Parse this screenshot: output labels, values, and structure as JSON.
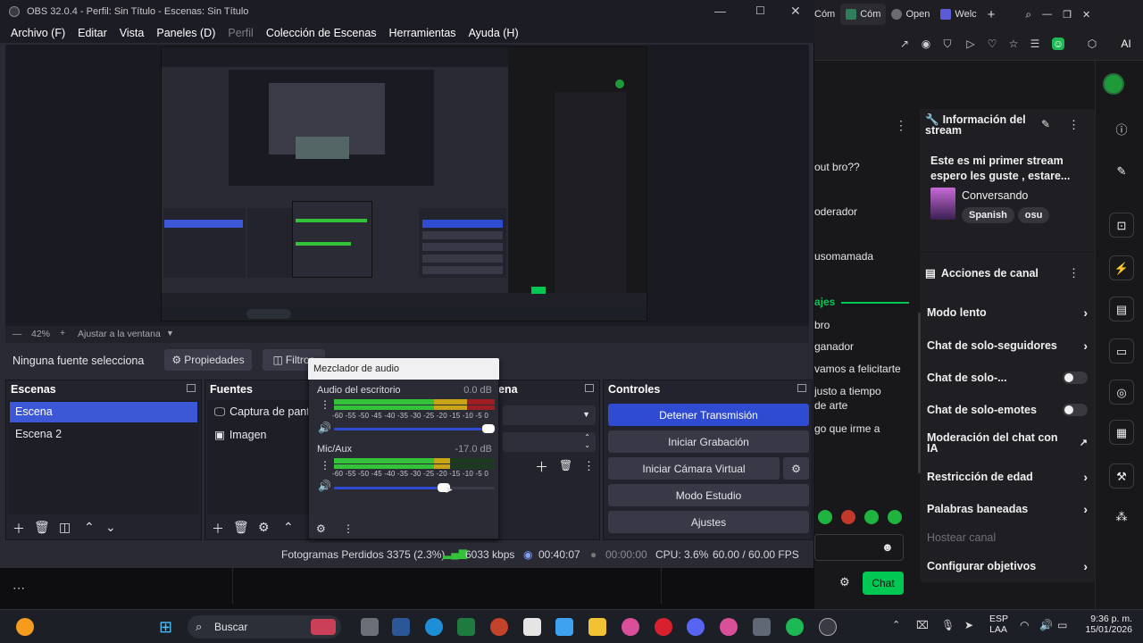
{
  "obs": {
    "title": "OBS 32.0.4 - Perfil: Sin Título - Escenas: Sin Título",
    "menu": [
      "Archivo (F)",
      "Editar",
      "Vista",
      "Paneles (D)",
      "Perfil",
      "Colección de Escenas",
      "Herramientas",
      "Ayuda (H)"
    ],
    "zoom": {
      "value": "42%",
      "fit_label": "Ajustar a la ventana"
    },
    "source_bar": {
      "status": "Ninguna fuente selecciona",
      "properties_label": "Propiedades",
      "filters_label": "Filtros"
    },
    "scenes": {
      "title": "Escenas",
      "items": [
        "Escena",
        "Escena 2"
      ],
      "selected": 0
    },
    "sources": {
      "title": "Fuentes",
      "items": [
        {
          "icon": "monitor-icon",
          "label": "Captura de pantal"
        },
        {
          "icon": "image-icon",
          "label": "Imagen"
        }
      ]
    },
    "transitions": {
      "title_fragment": "ena"
    },
    "controls": {
      "title": "Controles",
      "buttons": [
        "Detener Transmisión",
        "Iniciar Grabación",
        "Iniciar Cámara Virtual",
        "Modo Estudio",
        "Ajustes"
      ]
    },
    "mixer": {
      "title": "Mezclador de audio",
      "scale": [
        "-60",
        "-55",
        "-50",
        "-45",
        "-40",
        "-35",
        "-30",
        "-25",
        "-20",
        "-15",
        "-10",
        "-5",
        "0"
      ],
      "channels": [
        {
          "name": "Audio del escritorio",
          "db": "0.0 dB",
          "level": 1.0
        },
        {
          "name": "Mic/Aux",
          "db": "-17.0 dB",
          "level": 0.72
        }
      ]
    },
    "status": {
      "dropped_frames": "Fotogramas Perdidos 3375 (2.3%)",
      "bitrate": "6033 kbps",
      "stream_time": "00:40:07",
      "rec_time": "00:00:00",
      "cpu": "CPU: 3.6%",
      "fps": "60.00 / 60.00 FPS"
    }
  },
  "browser": {
    "tabs": [
      "Cóm",
      "Cóm",
      "Open",
      "Welc"
    ],
    "chat_fragments": [
      "out bro??",
      "oderador",
      "usomamada",
      "ajes",
      "bro",
      "ganador",
      "vamos a felicitarte",
      "justo a tiempo",
      "de arte",
      "go que irme a"
    ],
    "chat_button": "Chat",
    "stream_info": {
      "header": "Información del stream",
      "title": "Este es mi primer stream espero les guste , estare...",
      "category": "Conversando",
      "tags": [
        "Spanish",
        "osu"
      ]
    },
    "channel_actions": {
      "header": "Acciones de canal",
      "rows": [
        {
          "label": "Modo lento",
          "kind": "chevron"
        },
        {
          "label": "Chat de solo-seguidores",
          "kind": "chevron"
        },
        {
          "label": "Chat de solo-...",
          "kind": "toggle"
        },
        {
          "label": "Chat de solo-emotes",
          "kind": "toggle"
        },
        {
          "label": "Moderación del chat con IA",
          "kind": "external"
        },
        {
          "label": "Restricción de edad",
          "kind": "chevron"
        },
        {
          "label": "Palabras baneadas",
          "kind": "chevron"
        },
        {
          "label": "Hostear canal",
          "kind": "disabled"
        },
        {
          "label": "Configurar objetivos",
          "kind": "chevron"
        }
      ]
    }
  },
  "taskbar": {
    "search_label": "Buscar",
    "lang": "ESP",
    "lang2": "LAA",
    "time": "9:36 p. m.",
    "date": "15/01/2026"
  },
  "colors": {
    "obs_accent": "#2f4bd1",
    "twitch_green": "#00c853",
    "meter_green": "#35c23b"
  }
}
